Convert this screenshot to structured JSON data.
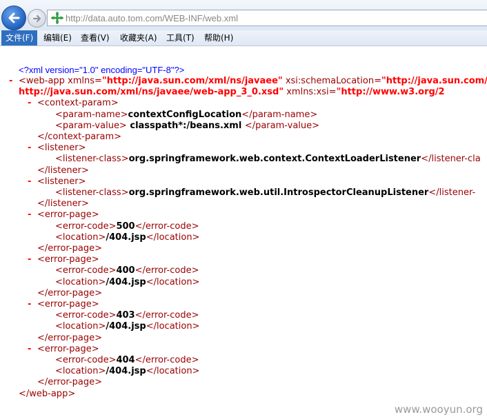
{
  "address_bar": {
    "url": "http://data.auto.tom.com/WEB-INF/web.xml"
  },
  "icons": {
    "back": "back-arrow-icon",
    "forward": "forward-arrow-icon",
    "site": "compatibility-view-icon"
  },
  "menu": {
    "items": [
      "文件(F)",
      "编辑(E)",
      "查看(V)",
      "收藏夹(A)",
      "工具(T)",
      "帮助(H)"
    ],
    "active_index": 0
  },
  "xml": {
    "pi": "<?xml version=\"1.0\" encoding=\"UTF-8\"?>",
    "lines": [
      {
        "parts": [
          [
            "tag",
            "<web-app "
          ],
          [
            "an",
            "xmlns="
          ],
          [
            "av",
            "\"http://java.sun.com/xml/ns/javaee\""
          ],
          [
            "an",
            " xsi:schemaLocation="
          ],
          [
            "av",
            "\"http://java.sun.com/xml/ns/javaee"
          ]
        ]
      },
      {
        "parts": [
          [
            "av",
            "http://java.sun.com/xml/ns/javaee/web-app_3_0.xsd\""
          ],
          [
            "an",
            " xmlns:xsi="
          ],
          [
            "av",
            "\"http://www.w3.org/2"
          ]
        ]
      },
      {
        "parts": [
          [
            "tag",
            "<context-param>"
          ]
        ]
      },
      {
        "parts": [
          [
            "tag",
            "<param-name>"
          ],
          [
            "txt",
            "contextConfigLocation"
          ],
          [
            "tag",
            "</param-name>"
          ]
        ]
      },
      {
        "parts": [
          [
            "tag",
            "<param-value>"
          ],
          [
            "txt",
            " classpath*:/beans.xml "
          ],
          [
            "tag",
            "</param-value>"
          ]
        ]
      },
      {
        "parts": [
          [
            "tag",
            "</context-param>"
          ]
        ]
      },
      {
        "parts": [
          [
            "tag",
            "<listener>"
          ]
        ]
      },
      {
        "parts": [
          [
            "tag",
            "<listener-class>"
          ],
          [
            "txt",
            "org.springframework.web.context.ContextLoaderListener"
          ],
          [
            "tag",
            "</listener-cla"
          ]
        ]
      },
      {
        "parts": [
          [
            "tag",
            "</listener>"
          ]
        ]
      },
      {
        "parts": [
          [
            "tag",
            "<listener>"
          ]
        ]
      },
      {
        "parts": [
          [
            "tag",
            "<listener-class>"
          ],
          [
            "txt",
            "org.springframework.web.util.IntrospectorCleanupListener"
          ],
          [
            "tag",
            "</listener-"
          ]
        ]
      },
      {
        "parts": [
          [
            "tag",
            "</listener>"
          ]
        ]
      },
      {
        "parts": [
          [
            "tag",
            "<error-page>"
          ]
        ]
      },
      {
        "parts": [
          [
            "tag",
            "<error-code>"
          ],
          [
            "txt",
            "500"
          ],
          [
            "tag",
            "</error-code>"
          ]
        ]
      },
      {
        "parts": [
          [
            "tag",
            "<location>"
          ],
          [
            "txt",
            "/404.jsp"
          ],
          [
            "tag",
            "</location>"
          ]
        ]
      },
      {
        "parts": [
          [
            "tag",
            "</error-page>"
          ]
        ]
      },
      {
        "parts": [
          [
            "tag",
            "<error-page>"
          ]
        ]
      },
      {
        "parts": [
          [
            "tag",
            "<error-code>"
          ],
          [
            "txt",
            "400"
          ],
          [
            "tag",
            "</error-code>"
          ]
        ]
      },
      {
        "parts": [
          [
            "tag",
            "<location>"
          ],
          [
            "txt",
            "/404.jsp"
          ],
          [
            "tag",
            "</location>"
          ]
        ]
      },
      {
        "parts": [
          [
            "tag",
            "</error-page>"
          ]
        ]
      },
      {
        "parts": [
          [
            "tag",
            "<error-page>"
          ]
        ]
      },
      {
        "parts": [
          [
            "tag",
            "<error-code>"
          ],
          [
            "txt",
            "403"
          ],
          [
            "tag",
            "</error-code>"
          ]
        ]
      },
      {
        "parts": [
          [
            "tag",
            "<location>"
          ],
          [
            "txt",
            "/404.jsp"
          ],
          [
            "tag",
            "</location>"
          ]
        ]
      },
      {
        "parts": [
          [
            "tag",
            "</error-page>"
          ]
        ]
      },
      {
        "parts": [
          [
            "tag",
            "<error-page>"
          ]
        ]
      },
      {
        "parts": [
          [
            "tag",
            "<error-code>"
          ],
          [
            "txt",
            "404"
          ],
          [
            "tag",
            "</error-code>"
          ]
        ]
      },
      {
        "parts": [
          [
            "tag",
            "<location>"
          ],
          [
            "txt",
            "/404.jsp"
          ],
          [
            "tag",
            "</location>"
          ]
        ]
      },
      {
        "parts": [
          [
            "tag",
            "</error-page>"
          ]
        ]
      },
      {
        "parts": [
          [
            "tag",
            "</web-app>"
          ]
        ]
      }
    ],
    "collapse_marker": "-"
  },
  "watermark": "www.wooyun.org"
}
